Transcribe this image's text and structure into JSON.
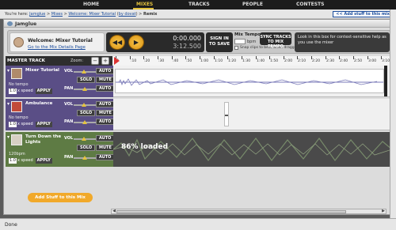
{
  "nav": {
    "items": [
      {
        "label": "HOME",
        "active": false
      },
      {
        "label": "MIXES",
        "active": true
      },
      {
        "label": "TRACKS",
        "active": false
      },
      {
        "label": "PEOPLE",
        "active": false
      },
      {
        "label": "CONTESTS",
        "active": false
      }
    ]
  },
  "breadcrumb": {
    "prefix": "You're here:",
    "items": [
      "Jamglue",
      "Mixes",
      "Welcome: Mixer Tutorial",
      "by dovat"
    ],
    "current": "Remix",
    "add_button": "<< Add stuff to this mix"
  },
  "window": {
    "title": "Jamglue"
  },
  "header": {
    "mix_title": "Welcome: Mixer Tutorial",
    "mix_link": "Go to the Mix Details Page",
    "rewind_symbol": "◀◀",
    "play_symbol": "▶",
    "time_current": "0:00.000",
    "time_total": "3:12.500",
    "signin_label": "SIGN IN TO SAVE",
    "tempo_label": "Mix Tempo",
    "tempo_value": "",
    "bpm_label": "bpm",
    "snap_label": "Snap clips to beat when dragged",
    "sync_label": "SYNC TRACKS TO MIX TEMPO",
    "help_text": "Look in this box for context-sensitive help as you use the mixer"
  },
  "timeline": {
    "master_label": "MASTER TRACK",
    "zoom_label": "Zoom:",
    "zoom_out": "−",
    "zoom_in": "+",
    "ticks": [
      "0",
      ":10",
      ":20",
      ":30",
      ":40",
      ":50",
      "1:00",
      "1:10",
      "1:20",
      "1:30",
      "1:40",
      "1:50",
      "2:00",
      "2:10",
      "2:20",
      "2:30",
      "2:40",
      "2:50",
      "3:00",
      "3:10"
    ]
  },
  "tracks": [
    {
      "name": "Mixer Tutorial",
      "tempo": "No tempo",
      "speed": "1.0",
      "speed_label": "x speed",
      "apply": "APPLY",
      "color": "#5a4e86",
      "vol": "VOL",
      "pan": "PAN",
      "auto": "AUTO",
      "solo": "SOLO",
      "mute": "MUTE",
      "loaded": ""
    },
    {
      "name": "Ambulance",
      "tempo": "No tempo",
      "speed": "1.0",
      "speed_label": "x speed",
      "apply": "APPLY",
      "color": "#5a4e86",
      "vol": "VOL",
      "pan": "PAN",
      "auto": "AUTO",
      "solo": "SOLO",
      "mute": "MUTE",
      "loaded": ""
    },
    {
      "name": "Turn Down the Lights",
      "tempo": "120bpm",
      "speed": "1.0",
      "speed_label": "x speed",
      "apply": "APPLY",
      "color": "#5e7b44",
      "vol": "VOL",
      "pan": "PAN",
      "auto": "AUTO",
      "solo": "SOLO",
      "mute": "MUTE",
      "loaded": "86% loaded"
    }
  ],
  "add_stuff_button": "Add Stuff to this Mix",
  "status": {
    "text": "Done"
  },
  "colors": {
    "accent": "#e5c33e",
    "link": "#1b4c9b",
    "orange_button": "#f1a92a"
  }
}
